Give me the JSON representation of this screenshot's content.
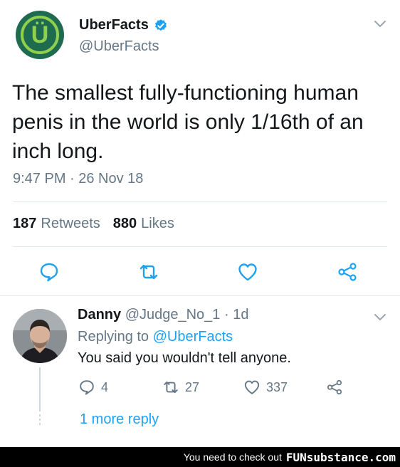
{
  "tweet": {
    "display_name": "UberFacts",
    "handle": "@UberFacts",
    "avatar_letter": "Ü",
    "text": "The smallest fully-functioning human penis in the world is only 1/16th of an inch long.",
    "timestamp": "9:47 PM · 26 Nov 18",
    "retweets_count": "187",
    "retweets_label": "Retweets",
    "likes_count": "880",
    "likes_label": "Likes"
  },
  "reply": {
    "display_name": "Danny",
    "handle": "@Judge_No_1",
    "time": "· 1d",
    "replying_prefix": "Replying to",
    "replying_to": "@UberFacts",
    "text": "You said you wouldn't tell anyone.",
    "reply_count": "4",
    "retweet_count": "27",
    "like_count": "337",
    "more_replies": "1 more reply"
  },
  "footer": {
    "text": "You need to check out",
    "brand": "FUNsubstance.com"
  },
  "colors": {
    "link": "#1da1f2",
    "secondary_text": "#657786",
    "icon": "#1da1f2",
    "divider": "#e1e8ed",
    "avatar_bg": "#1f6b50",
    "avatar_accent": "#8fd14f"
  },
  "icons": {
    "verified": "verified-badge-icon",
    "chevron": "chevron-down-icon",
    "reply": "reply-bubble-icon",
    "retweet": "retweet-icon",
    "like": "heart-icon",
    "share": "share-icon"
  }
}
